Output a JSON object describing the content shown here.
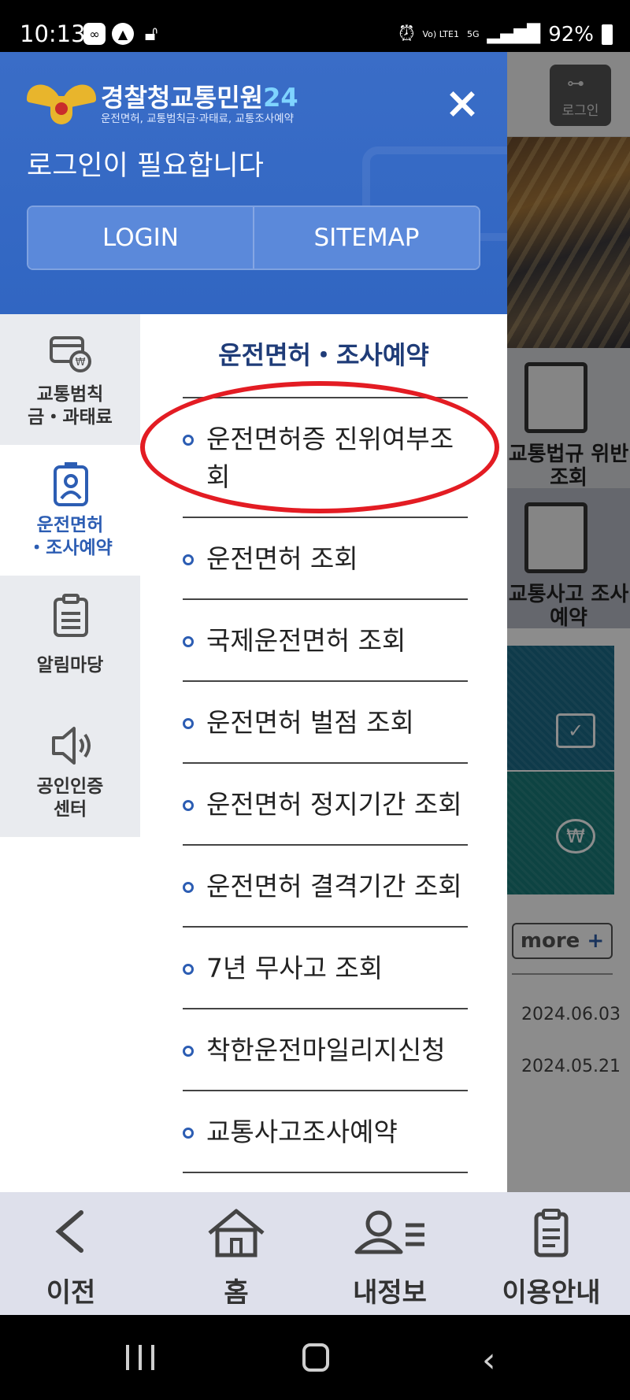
{
  "status_bar": {
    "time": "10:13",
    "network_label": "Vo) LTE1",
    "network_type": "5G",
    "battery": "92%"
  },
  "background_page": {
    "login_label": "로그인",
    "card1_label": "교통법규 위반조회",
    "card2_label": "교통사고 조사예약",
    "more_label": "more",
    "more_plus": "+",
    "dates": [
      "2024.06.03",
      "2024.05.21"
    ]
  },
  "drawer": {
    "logo_title": "경찰청교통민원",
    "logo_title_num": "24",
    "logo_subtitle": "운전면허, 교통범칙금·과태료, 교통조사예약",
    "close_icon": "×",
    "login_message": "로그인이 필요합니다",
    "login_button": "LOGIN",
    "sitemap_button": "SITEMAP",
    "categories": [
      {
        "label": "교통범칙\n금・과태료",
        "icon": "fine-card-icon",
        "active": false
      },
      {
        "label": "운전면허\n・조사예약",
        "icon": "license-badge-icon",
        "active": true
      },
      {
        "label": "알림마당",
        "icon": "clipboard-list-icon",
        "active": false
      },
      {
        "label": "공인인증\n센터",
        "icon": "speaker-icon",
        "active": false
      }
    ],
    "menu_title": "운전면허・조사예약",
    "menu_items": [
      "운전면허증 진위여부조회",
      "운전면허 조회",
      "국제운전면허 조회",
      "운전면허 벌점 조회",
      "운전면허 정지기간 조회",
      "운전면허 결격기간 조회",
      "7년 무사고 조회",
      "착한운전마일리지신청",
      "교통사고조사예약"
    ],
    "highlight_color": "#e31c23",
    "accent_color": "#3166c2"
  },
  "tabbar": {
    "items": [
      {
        "label": "이전",
        "icon": "back-chevron-icon"
      },
      {
        "label": "홈",
        "icon": "home-icon"
      },
      {
        "label": "내정보",
        "icon": "user-list-icon"
      },
      {
        "label": "이용안내",
        "icon": "guide-clipboard-icon"
      }
    ]
  }
}
